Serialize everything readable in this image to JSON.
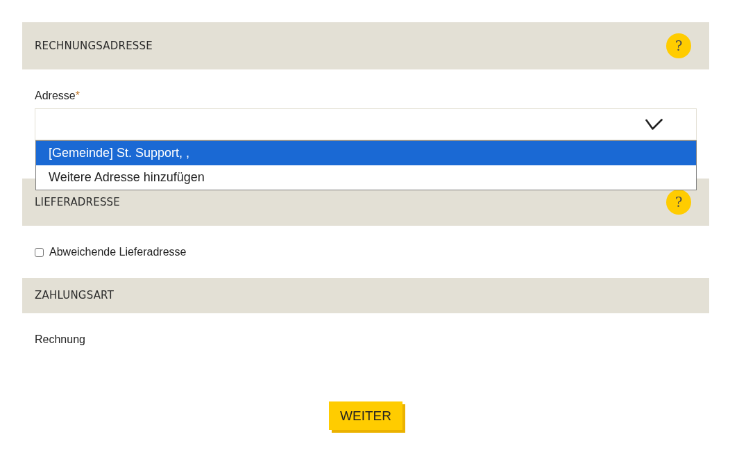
{
  "billing_address": {
    "title": "RECHNUNGSADRESSE",
    "help": "?",
    "address": {
      "label": "Adresse",
      "required_mark": "*",
      "expanded": true,
      "options": [
        {
          "label": "[Gemeinde] St. Support, ,",
          "selected": true
        },
        {
          "label": "Weitere Adresse hinzufügen",
          "selected": false
        }
      ]
    }
  },
  "delivery_address": {
    "title": "LIEFERADRESSE",
    "help": "?",
    "different_address": {
      "label": "Abweichende Lieferadresse",
      "checked": false
    }
  },
  "payment_method": {
    "title": "ZAHLUNGSART",
    "value": "Rechnung"
  },
  "next_button": "WEITER"
}
